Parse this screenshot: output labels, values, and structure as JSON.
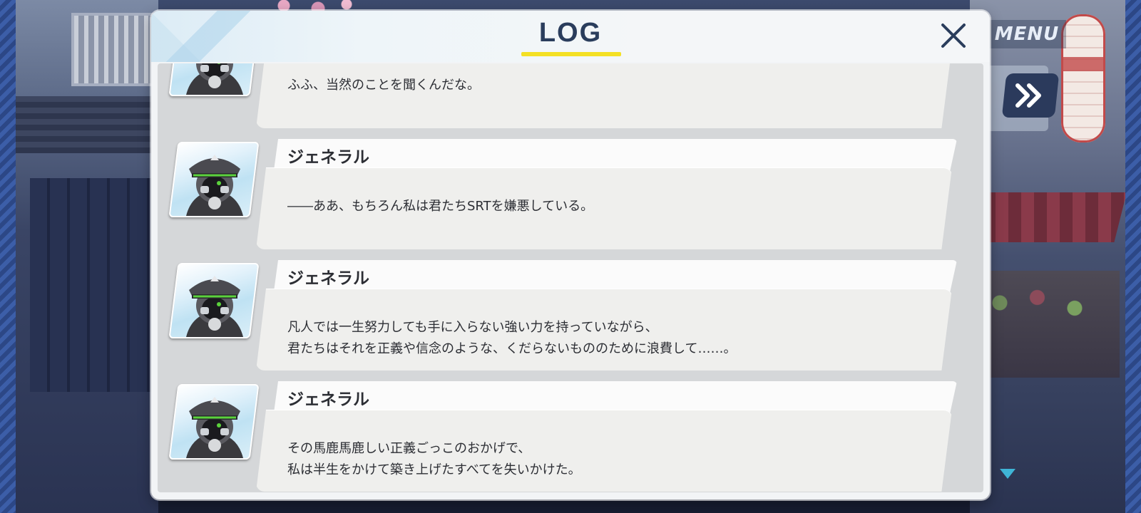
{
  "hud": {
    "menu_label": "MENU",
    "fast_forward_icon": "double-chevron-right-icon"
  },
  "dialog": {
    "title": "LOG",
    "close_icon": "close-x-icon"
  },
  "entries": [
    {
      "speaker": "",
      "lines": [
        "ふふ、当然のことを聞くんだな。",
        ""
      ]
    },
    {
      "speaker": "ジェネラル",
      "lines": [
        "――ああ、もちろん私は君たちSRTを嫌悪している。",
        ""
      ]
    },
    {
      "speaker": "ジェネラル",
      "lines": [
        "凡人では一生努力しても手に入らない強い力を持っていながら、",
        "君たちはそれを正義や信念のような、くだらないもののために浪費して……。"
      ]
    },
    {
      "speaker": "ジェネラル",
      "lines": [
        "その馬鹿馬鹿しい正義ごっこのおかげで、",
        "私は半生をかけて築き上げたすべてを失いかけた。"
      ]
    }
  ],
  "colors": {
    "title": "#2a3d5c",
    "underline": "#f4e024",
    "text": "#2c2e34",
    "accent_green": "#5bd23c"
  }
}
